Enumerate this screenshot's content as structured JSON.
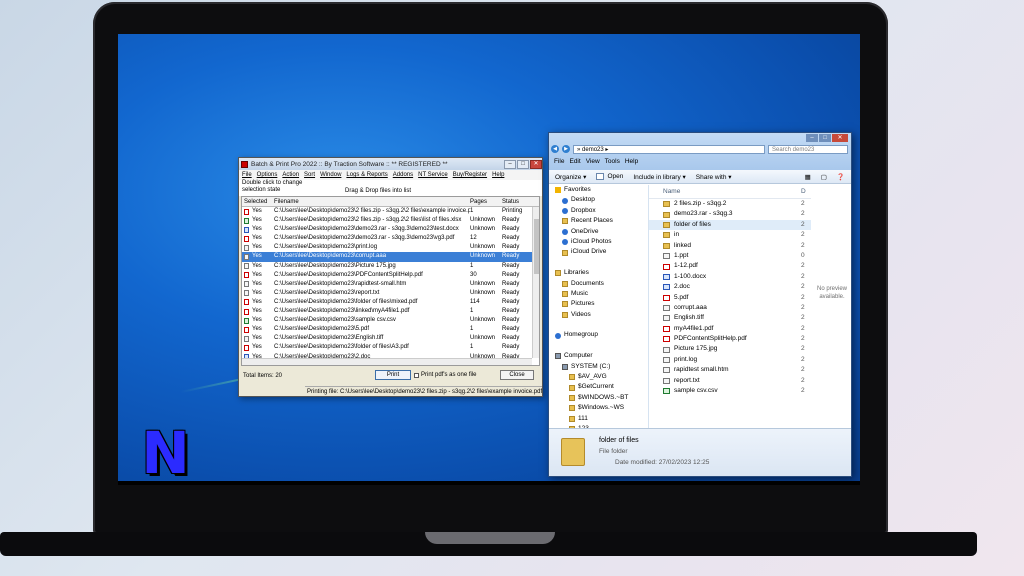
{
  "batch_window": {
    "title": "Batch & Print Pro 2022 :: By Traction Software :: ** REGISTERED **",
    "menu": [
      "File",
      "Options",
      "Action",
      "Sort",
      "Window",
      "Logs & Reports",
      "Addons",
      "NT Service",
      "Buy/Register",
      "Help"
    ],
    "info_line1": "Double click to change",
    "info_line2": "selection state",
    "drag_hint": "Drag & Drop files into list",
    "columns": {
      "selected": "Selected",
      "filename": "Filename",
      "pages": "Pages",
      "status": "Status"
    },
    "rows": [
      {
        "icon": "pdf",
        "selected": "Yes",
        "filename": "C:\\Users\\lee\\Desktop\\demo23\\2 files.zip - s3qg.2\\2 files\\example invoice.pdf",
        "pages": "1",
        "status": "Printing"
      },
      {
        "icon": "xls",
        "selected": "Yes",
        "filename": "C:\\Users\\lee\\Desktop\\demo23\\2 files.zip - s3qg.2\\2 files\\list of files.xlsx",
        "pages": "Unknown",
        "status": "Ready"
      },
      {
        "icon": "doc",
        "selected": "Yes",
        "filename": "C:\\Users\\lee\\Desktop\\demo23\\demo23.rar - s3qg.3\\demo23\\test.docx",
        "pages": "Unknown",
        "status": "Ready"
      },
      {
        "icon": "pdf",
        "selected": "Yes",
        "filename": "C:\\Users\\lee\\Desktop\\demo23\\demo23.rar - s3qg.3\\demo23\\vg3.pdf",
        "pages": "12",
        "status": "Ready"
      },
      {
        "icon": "gen",
        "selected": "Yes",
        "filename": "C:\\Users\\lee\\Desktop\\demo23\\print.log",
        "pages": "Unknown",
        "status": "Ready"
      },
      {
        "icon": "gen",
        "selected": "Yes",
        "filename": "C:\\Users\\lee\\Desktop\\demo23\\corrupt.aaa",
        "pages": "Unknown",
        "status": "Ready",
        "highlighted": true
      },
      {
        "icon": "gen",
        "selected": "Yes",
        "filename": "C:\\Users\\lee\\Desktop\\demo23\\Picture 175.jpg",
        "pages": "1",
        "status": "Ready"
      },
      {
        "icon": "pdf",
        "selected": "Yes",
        "filename": "C:\\Users\\lee\\Desktop\\demo23\\PDFContentSplitHelp.pdf",
        "pages": "30",
        "status": "Ready"
      },
      {
        "icon": "gen",
        "selected": "Yes",
        "filename": "C:\\Users\\lee\\Desktop\\demo23\\rapidtest-small.htm",
        "pages": "Unknown",
        "status": "Ready"
      },
      {
        "icon": "gen",
        "selected": "Yes",
        "filename": "C:\\Users\\lee\\Desktop\\demo23\\report.txt",
        "pages": "Unknown",
        "status": "Ready"
      },
      {
        "icon": "pdf",
        "selected": "Yes",
        "filename": "C:\\Users\\lee\\Desktop\\demo23\\folder of files\\mixed.pdf",
        "pages": "114",
        "status": "Ready"
      },
      {
        "icon": "pdf",
        "selected": "Yes",
        "filename": "C:\\Users\\lee\\Desktop\\demo23\\linked\\myA4file1.pdf",
        "pages": "1",
        "status": "Ready"
      },
      {
        "icon": "xls",
        "selected": "Yes",
        "filename": "C:\\Users\\lee\\Desktop\\demo23\\sample csv.csv",
        "pages": "Unknown",
        "status": "Ready"
      },
      {
        "icon": "pdf",
        "selected": "Yes",
        "filename": "C:\\Users\\lee\\Desktop\\demo23\\5.pdf",
        "pages": "1",
        "status": "Ready"
      },
      {
        "icon": "gen",
        "selected": "Yes",
        "filename": "C:\\Users\\lee\\Desktop\\demo23\\English.tiff",
        "pages": "Unknown",
        "status": "Ready"
      },
      {
        "icon": "pdf",
        "selected": "Yes",
        "filename": "C:\\Users\\lee\\Desktop\\demo23\\folder of files\\A3.pdf",
        "pages": "1",
        "status": "Ready"
      },
      {
        "icon": "doc",
        "selected": "Yes",
        "filename": "C:\\Users\\lee\\Desktop\\demo23\\2.doc",
        "pages": "Unknown",
        "status": "Ready"
      }
    ],
    "total_items": "Total Items: 20",
    "print_button": "Print",
    "print_one_file": "Print pdf's as one file",
    "close_button": "Close",
    "status_text": "Printing file: C:\\Users\\lee\\Desktop\\demo23\\2 files.zip - s3qg.2\\2 files\\example invoice.pdf"
  },
  "explorer": {
    "address": "demo23",
    "search_placeholder": "Search demo23",
    "menu": [
      "File",
      "Edit",
      "View",
      "Tools",
      "Help"
    ],
    "toolbar": {
      "organize": "Organize",
      "open": "Open",
      "include": "Include in library",
      "share": "Share with"
    },
    "nav_items": [
      {
        "label": "Favorites",
        "icon": "star",
        "indent": 0
      },
      {
        "label": "Desktop",
        "icon": "blue",
        "indent": 1
      },
      {
        "label": "Dropbox",
        "icon": "blue",
        "indent": 1
      },
      {
        "label": "Recent Places",
        "icon": "folder",
        "indent": 1
      },
      {
        "label": "OneDrive",
        "icon": "blue",
        "indent": 1
      },
      {
        "label": "iCloud Photos",
        "icon": "blue",
        "indent": 1
      },
      {
        "label": "iCloud Drive",
        "icon": "folder",
        "indent": 1
      },
      {
        "label": "",
        "icon": "",
        "indent": 0
      },
      {
        "label": "Libraries",
        "icon": "folder",
        "indent": 0
      },
      {
        "label": "Documents",
        "icon": "folder",
        "indent": 1
      },
      {
        "label": "Music",
        "icon": "folder",
        "indent": 1
      },
      {
        "label": "Pictures",
        "icon": "folder",
        "indent": 1
      },
      {
        "label": "Videos",
        "icon": "folder",
        "indent": 1
      },
      {
        "label": "",
        "icon": "",
        "indent": 0
      },
      {
        "label": "Homegroup",
        "icon": "blue",
        "indent": 0
      },
      {
        "label": "",
        "icon": "",
        "indent": 0
      },
      {
        "label": "Computer",
        "icon": "drive",
        "indent": 0
      },
      {
        "label": "SYSTEM (C:)",
        "icon": "drive",
        "indent": 1
      },
      {
        "label": "$AV_AVG",
        "icon": "folder",
        "indent": 2
      },
      {
        "label": "$GetCurrent",
        "icon": "folder",
        "indent": 2
      },
      {
        "label": "$WINDOWS.~BT",
        "icon": "folder",
        "indent": 2
      },
      {
        "label": "$Windows.~WS",
        "icon": "folder",
        "indent": 2
      },
      {
        "label": "111",
        "icon": "folder",
        "indent": 2
      },
      {
        "label": "123",
        "icon": "folder",
        "indent": 2
      }
    ],
    "column_name": "Name",
    "column_date": "D",
    "files": [
      {
        "name": "2 files.zip - s3qg.2",
        "icon": "folder",
        "d": "2"
      },
      {
        "name": "demo23.rar - s3qg.3",
        "icon": "folder",
        "d": "2"
      },
      {
        "name": "folder of files",
        "icon": "folder",
        "d": "2",
        "selected": true
      },
      {
        "name": "in",
        "icon": "folder",
        "d": "2"
      },
      {
        "name": "linked",
        "icon": "folder",
        "d": "2"
      },
      {
        "name": "1.ppt",
        "icon": "gen",
        "d": "0"
      },
      {
        "name": "1-12.pdf",
        "icon": "pdf",
        "d": "2"
      },
      {
        "name": "1-100.docx",
        "icon": "doc",
        "d": "2"
      },
      {
        "name": "2.doc",
        "icon": "doc",
        "d": "2"
      },
      {
        "name": "5.pdf",
        "icon": "pdf",
        "d": "2"
      },
      {
        "name": "corrupt.aaa",
        "icon": "gen",
        "d": "2"
      },
      {
        "name": "English.tiff",
        "icon": "gen",
        "d": "2"
      },
      {
        "name": "myA4file1.pdf",
        "icon": "pdf",
        "d": "2"
      },
      {
        "name": "PDFContentSplitHelp.pdf",
        "icon": "pdf",
        "d": "2"
      },
      {
        "name": "Picture 175.jpg",
        "icon": "gen",
        "d": "2"
      },
      {
        "name": "print.log",
        "icon": "gen",
        "d": "2"
      },
      {
        "name": "rapidtest small.htm",
        "icon": "gen",
        "d": "2"
      },
      {
        "name": "report.txt",
        "icon": "gen",
        "d": "2"
      },
      {
        "name": "sample csv.csv",
        "icon": "xls",
        "d": "2"
      }
    ],
    "preview_text_1": "No preview",
    "preview_text_2": "available.",
    "details": {
      "name": "folder of files",
      "type": "File folder",
      "modified": "Date modified: 27/02/2023 12:25"
    }
  },
  "desktop": {
    "logo_letter": "N"
  }
}
